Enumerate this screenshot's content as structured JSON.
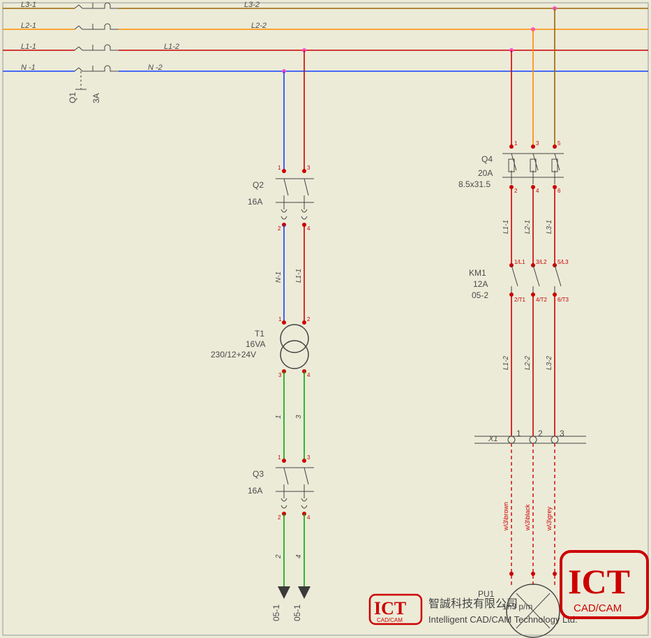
{
  "bus": {
    "L3_1": "L3-1",
    "L3_2": "L3-2",
    "L2_1": "L2-1",
    "L2_2": "L2-2",
    "L1_1": "L1-1",
    "L1_2": "L1-2",
    "N_1": "N -1",
    "N_2": "N -2"
  },
  "Q1": {
    "ref": "Q1",
    "rating": "3A"
  },
  "Q2": {
    "ref": "Q2",
    "rating": "16A",
    "pins": {
      "t1": "1",
      "t2": "3",
      "b1": "2",
      "b2": "4"
    },
    "nets": {
      "left": "N-1",
      "right": "L1-1"
    }
  },
  "T1": {
    "ref": "T1",
    "rating": "16VA",
    "voltage": "230/12+24V",
    "pins": {
      "p1": "1",
      "p2": "2",
      "p3": "3",
      "p4": "4"
    },
    "outnets": {
      "left": "1",
      "right": "3"
    }
  },
  "Q3": {
    "ref": "Q3",
    "rating": "16A",
    "pins": {
      "t1": "1",
      "t2": "3",
      "b1": "2",
      "b2": "4"
    },
    "outnets": {
      "left": "2",
      "right": "4"
    },
    "targets": {
      "left": "05-1",
      "right": "05-1"
    }
  },
  "Q4": {
    "ref": "Q4",
    "rating": "20A",
    "size": "8.5x31.5",
    "pins": {
      "t1": "1",
      "t2": "3",
      "t3": "5",
      "b1": "2",
      "b2": "4",
      "b3": "6"
    },
    "nets": {
      "a": "L1-1",
      "b": "L2-1",
      "c": "L3-1"
    }
  },
  "KM1": {
    "ref": "KM1",
    "rating": "12A",
    "xref": "05-2",
    "pins": {
      "t1": "1/L1",
      "t2": "3/L2",
      "t3": "5/L3",
      "b1": "2/T1",
      "b2": "4/T2",
      "b3": "6/T3"
    },
    "nets": {
      "a": "L1-2",
      "b": "L2-2",
      "c": "L3-2"
    }
  },
  "X1": {
    "ref": "X1",
    "pins": {
      "p1": "1",
      "p2": "2",
      "p3": "3"
    },
    "wires": {
      "a": "w\\3\\brown",
      "b": "w\\3\\black",
      "c": "w\\3\\grey"
    }
  },
  "PU1": {
    "ref": "PU1",
    "rating": "1n3 p/m"
  },
  "logo": {
    "brand": "ICT",
    "tag": "CAD/CAM",
    "cn": "智誠科技有限公司",
    "en": "Intelligent CAD/CAM Technology Ltd."
  }
}
